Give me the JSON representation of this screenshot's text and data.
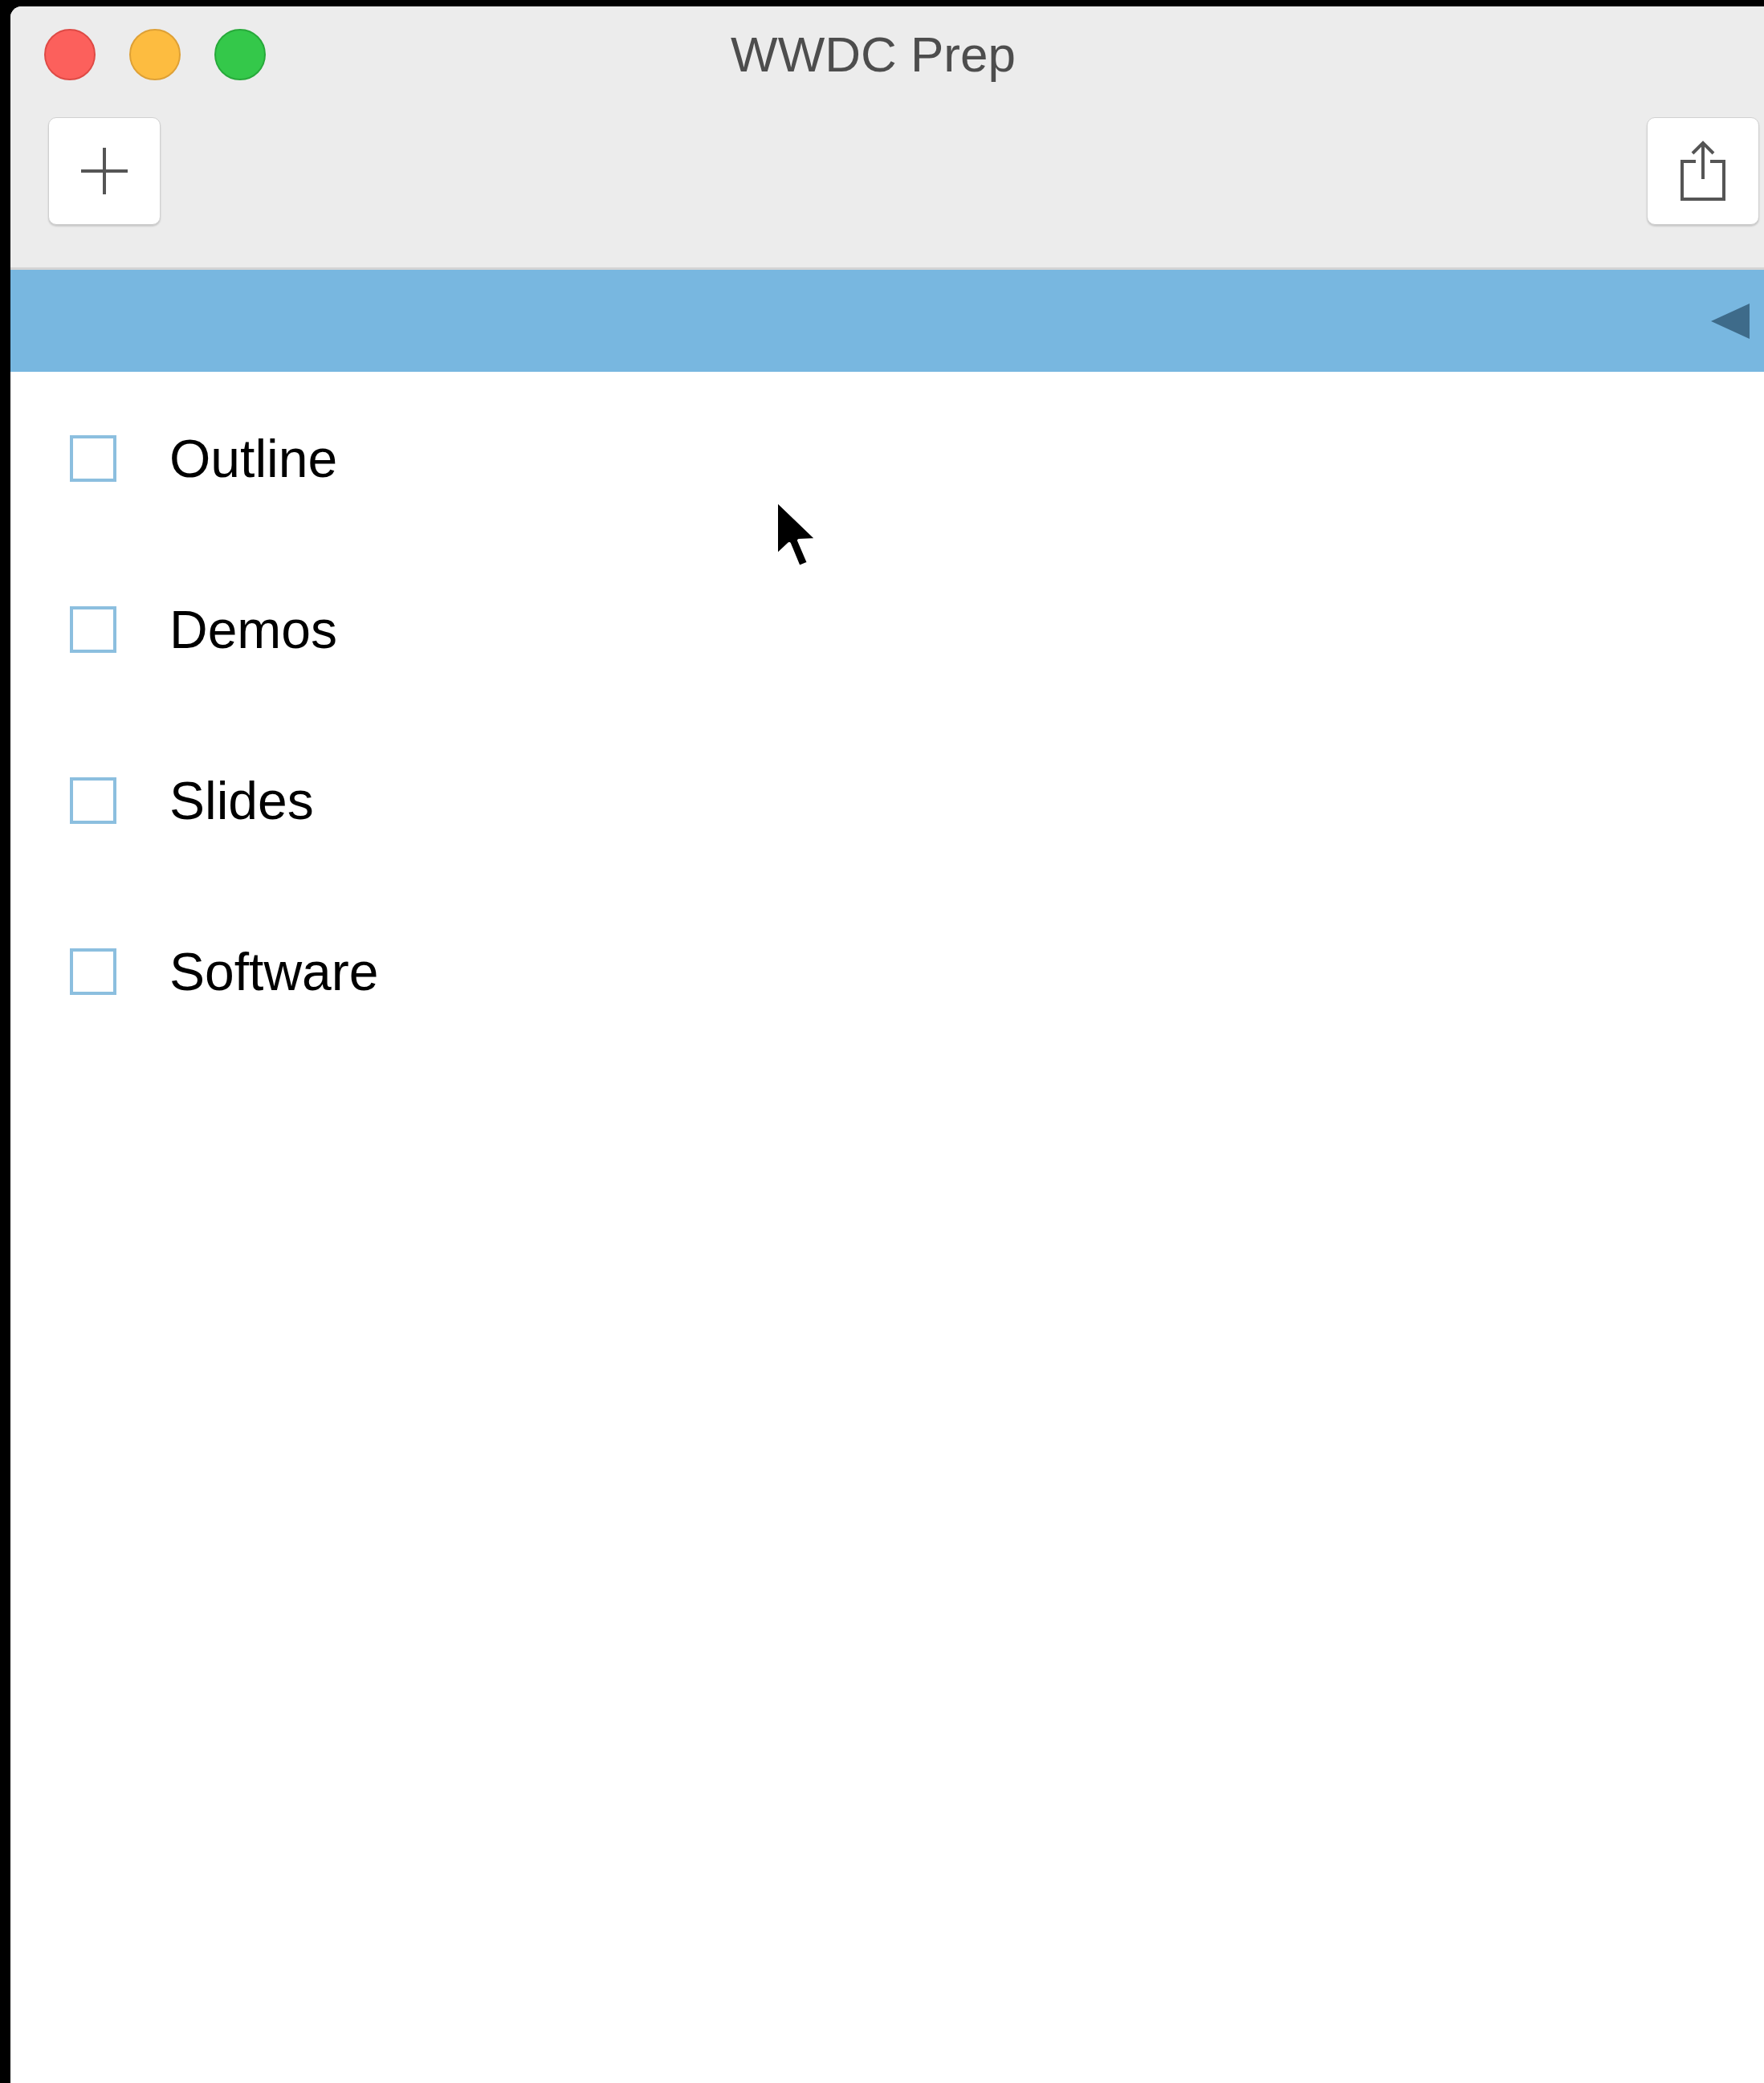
{
  "window": {
    "title": "WWDC Prep"
  },
  "items": [
    {
      "label": "Outline",
      "checked": false
    },
    {
      "label": "Demos",
      "checked": false
    },
    {
      "label": "Slides",
      "checked": false
    },
    {
      "label": "Software",
      "checked": false
    }
  ]
}
